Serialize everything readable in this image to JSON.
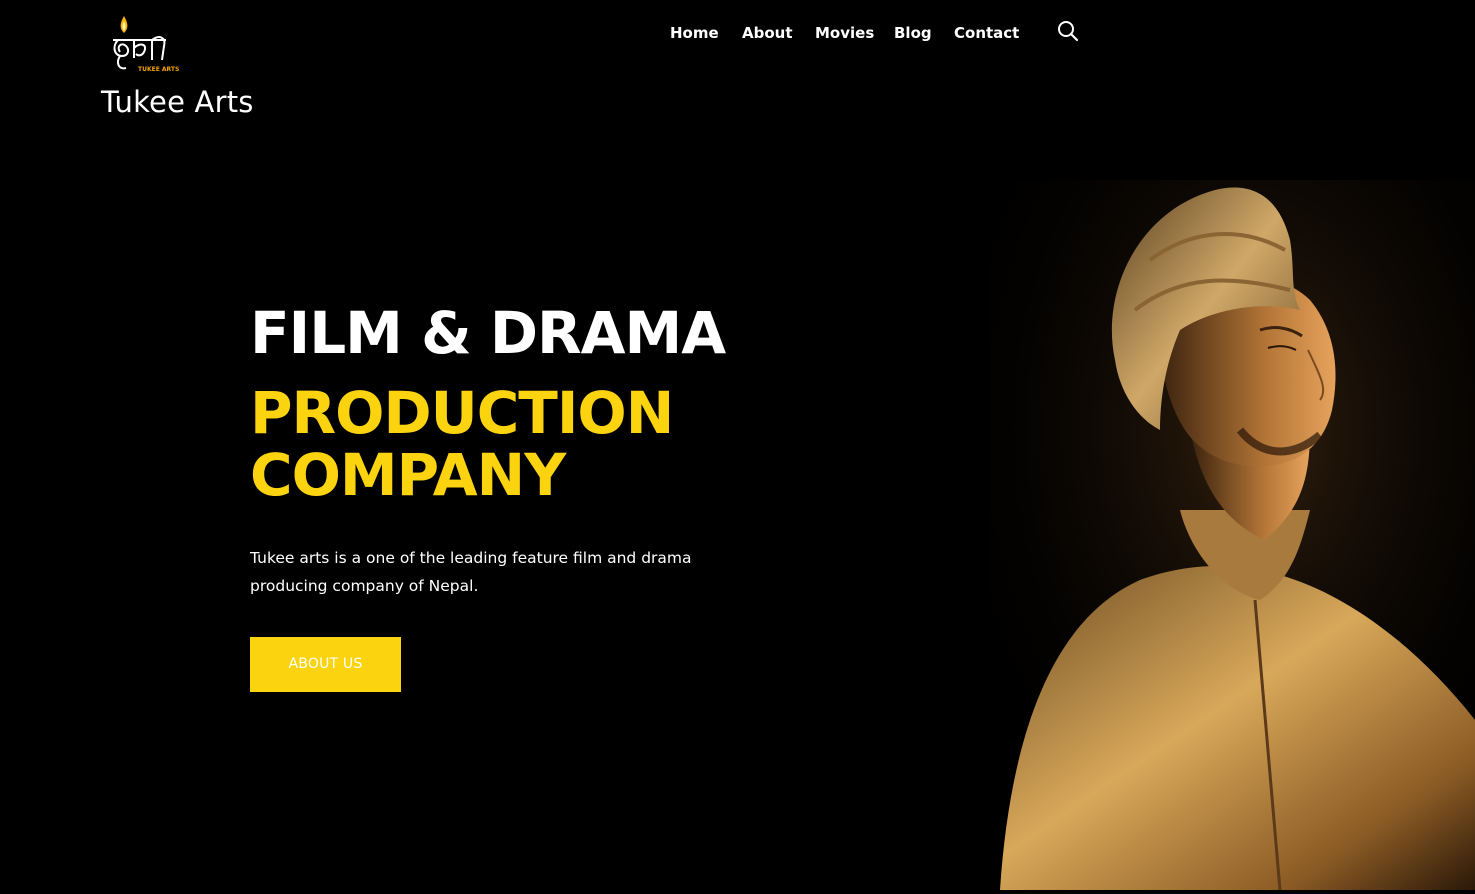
{
  "brand": {
    "logo_text": "TUKEE ARTS",
    "site_title": "Tukee Arts"
  },
  "nav": {
    "items": [
      {
        "label": "Home"
      },
      {
        "label": "About"
      },
      {
        "label": "Movies"
      },
      {
        "label": "Blog"
      },
      {
        "label": "Contact"
      }
    ],
    "search_icon": "search-icon"
  },
  "hero": {
    "line1": "FILM & DRAMA",
    "line2": "PRODUCTION",
    "line3": "COMPANY",
    "description": "Tukee arts is a one of the leading feature film and drama producing company of Nepal.",
    "cta_label": "ABOUT US"
  },
  "colors": {
    "background": "#000000",
    "accent": "#fcd30f",
    "text": "#ffffff"
  }
}
